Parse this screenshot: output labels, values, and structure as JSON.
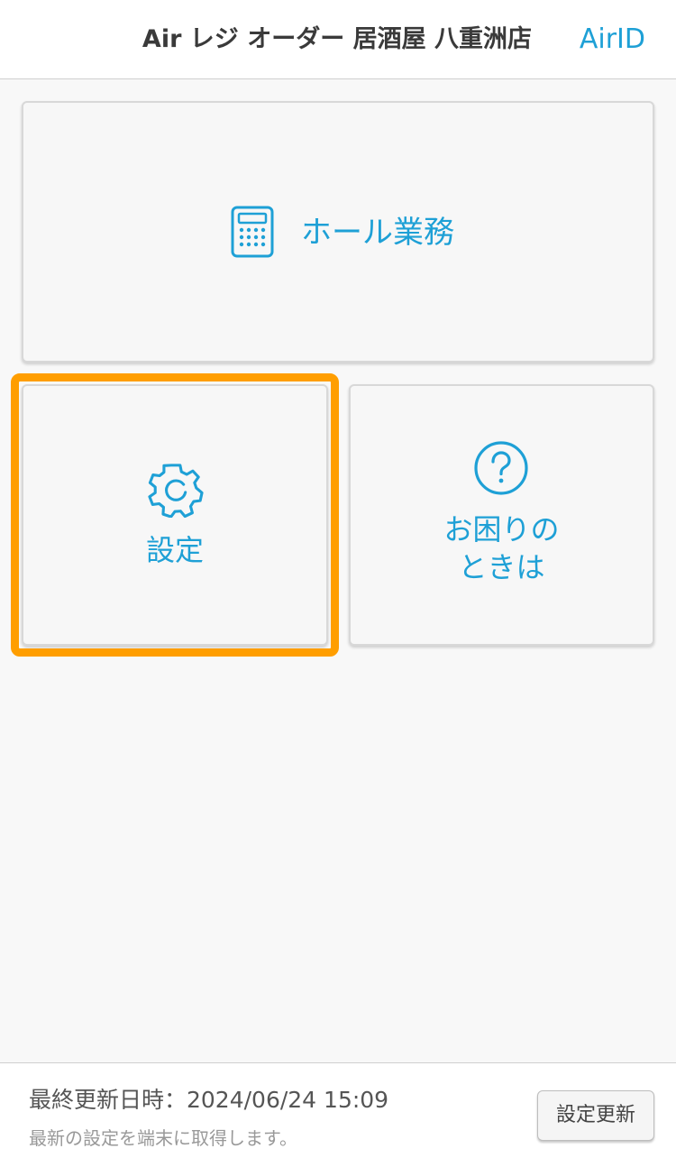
{
  "header": {
    "title": "Air レジ オーダー 居酒屋 八重洲店",
    "airid_link": "AirID"
  },
  "menu": {
    "hall": {
      "label": "ホール業務",
      "icon": "calculator-icon"
    },
    "settings": {
      "label": "設定",
      "icon": "gear-icon"
    },
    "help": {
      "label_line1": "お困りの",
      "label_line2": "ときは",
      "icon": "question-circle-icon"
    }
  },
  "footer": {
    "last_updated": "最終更新日時：2024/06/24 15:09",
    "note": "最新の設定を端末に取得します。",
    "update_button": "設定更新"
  },
  "colors": {
    "accent": "#1ea0d6",
    "highlight": "#ff9e00"
  }
}
